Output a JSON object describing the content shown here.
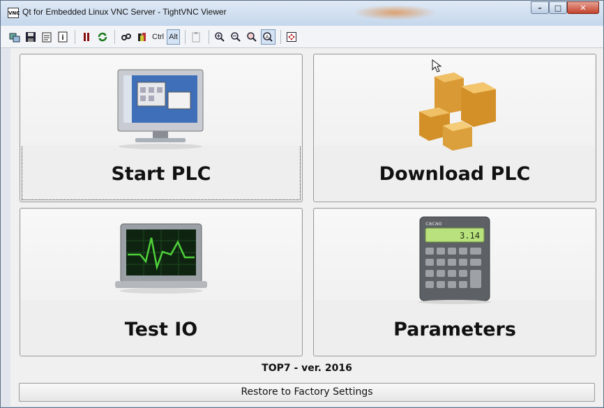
{
  "window": {
    "title": "Qt for Embedded Linux VNC Server - TightVNC Viewer",
    "app_icon_text": "VNC",
    "controls": {
      "minimize": "–",
      "maximize": "□",
      "close": "✕"
    }
  },
  "toolbar": {
    "ctrl_label": "Ctrl",
    "alt_label": "Alt",
    "icons": [
      "new-connection-icon",
      "save-icon",
      "options-icon",
      "info-icon",
      "pause-icon",
      "refresh-icon",
      "ctrl-alt-del-icon",
      "send-keys-icon",
      "ctrl-key-icon",
      "alt-key-icon",
      "clipboard-icon",
      "zoom-in-icon",
      "zoom-out-icon",
      "zoom-100-icon",
      "zoom-fit-icon",
      "fullscreen-icon"
    ]
  },
  "tiles": {
    "start_plc": "Start PLC",
    "download_plc": "Download PLC",
    "test_io": "Test IO",
    "parameters": "Parameters"
  },
  "calculator": {
    "brand": "cacao",
    "display": "3.14"
  },
  "footer": {
    "version": "TOP7 - ver. 2016",
    "restore_button": "Restore to Factory Settings"
  },
  "colors": {
    "title_bar": "#c5d7ec",
    "close_button": "#c3422c",
    "panel_bg": "#eeeeee",
    "monitor_green": "#4fd13a"
  }
}
